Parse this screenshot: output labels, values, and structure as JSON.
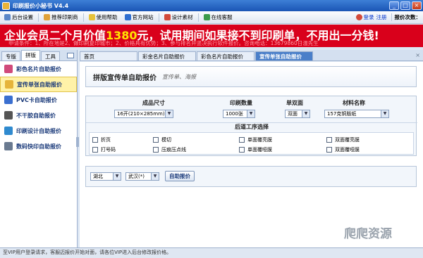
{
  "window": {
    "title": "印刷报价小秘书 V4.4",
    "minimize": "_",
    "maximize": "□",
    "close": "×"
  },
  "toolbar": {
    "items": [
      "后台设置",
      "推荐印刷商",
      "使用帮助",
      "官方网站",
      "设计素材",
      "在线客服"
    ],
    "login": "登录",
    "register": "注册",
    "quote_count_label": "报价次数：",
    "icon_colors": [
      "#5b87c8",
      "#e0a23a",
      "#e6c23b",
      "#2f6fd0",
      "#d24a3a",
      "#3a9a4a"
    ]
  },
  "banner": {
    "prefix": "企业会员二个月价值",
    "price": "1380",
    "suffix": "元，试用期间如果接不到印刷单，不用出一分钱!",
    "details": "申请条件：1、所在地是2、做印刷复印城市；2、价格具有优势；3、参与排名并竖决执行软件报价。咨询电话：13679860日温先生"
  },
  "sidebar": {
    "tabs": [
      "专版",
      "拼版",
      "工具"
    ],
    "active_tab": 1,
    "items": [
      {
        "label": "彩色名片自助报价",
        "icon": "card-icon",
        "color": "#d04a7a"
      },
      {
        "label": "宣传单张自助报价",
        "icon": "flyer-icon",
        "color": "#e6b43a"
      },
      {
        "label": "PVC卡自助报价",
        "icon": "pvc-card-icon",
        "color": "#3a6fd0"
      },
      {
        "label": "不干胶自助报价",
        "icon": "sticker-icon",
        "color": "#555"
      },
      {
        "label": "印刷设计自助报价",
        "icon": "design-icon",
        "color": "#2f8acf"
      },
      {
        "label": "数码快印自助报价",
        "icon": "printer-icon",
        "color": "#6a7a90"
      }
    ],
    "active_item": 1
  },
  "tabs": {
    "items": [
      "首页",
      "彩金名片自助报价",
      "彩色名片自助报价",
      "宣传单张自助报价"
    ],
    "active": 3,
    "close": "×"
  },
  "panel": {
    "title": "拼版宣传单自助报价",
    "subtitle": "宣传单、海报"
  },
  "form": {
    "headers": {
      "size": "成品尺寸",
      "quantity": "印刷数量",
      "sides": "单双面",
      "material": "材料名称"
    },
    "size_value": "16开(210×285mm)",
    "quantity_value": "1000张",
    "sides_value": "双面",
    "material_value": "157克铜版纸",
    "post_process_title": "后道工序选择",
    "options": [
      "折页",
      "模切",
      "单面覆亮膜",
      "双面覆亮膜",
      "打号码",
      "压痕压点线",
      "单面覆哑膜",
      "双面覆哑膜"
    ]
  },
  "bottom": {
    "province": "湖北",
    "city": "武汉(*)",
    "submit": "自助报价"
  },
  "watermark": "爬爬资源",
  "status": "至VIP用户登录请求，客服迈报价开始对面，请各位VIP进入后台修改报价格。"
}
